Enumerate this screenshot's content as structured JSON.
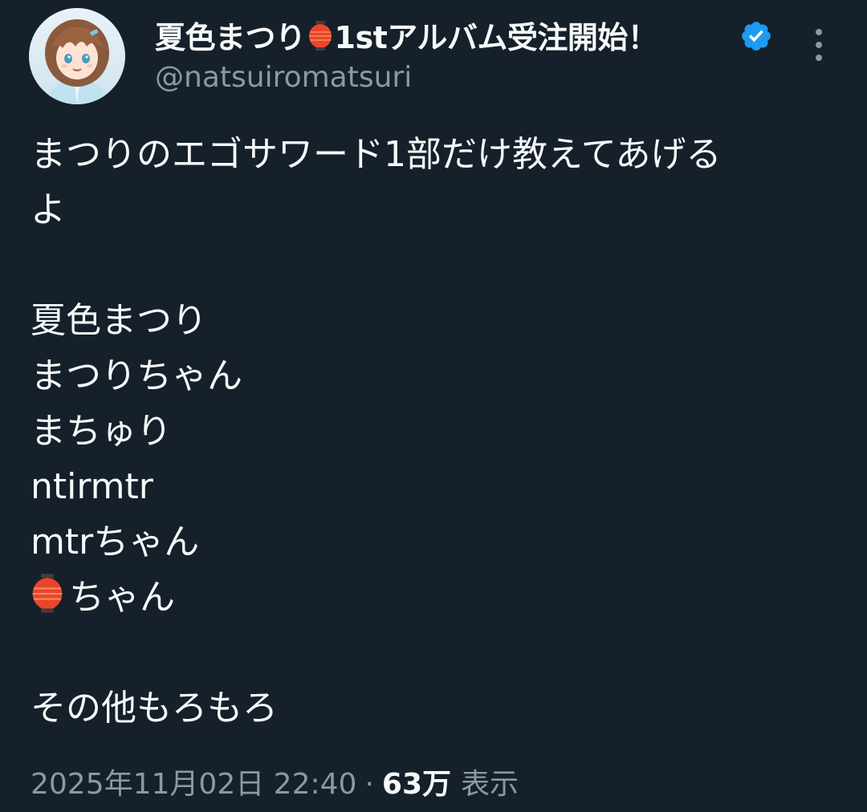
{
  "author": {
    "display_name": "夏色まつり",
    "display_name_suffix": "1stアルバム受注開始！",
    "handle": "@natsuiromatsuri"
  },
  "tweet": {
    "lines": [
      "まつりのエゴサワード1部だけ教えてあげる",
      "よ",
      "",
      "夏色まつり",
      "まつりちゃん",
      "まちゅり",
      "ntirmtr",
      "mtrちゃん",
      "ちゃん",
      "",
      "その他もろもろ"
    ]
  },
  "meta": {
    "timestamp": "2025年11月02日 22:40",
    "separator": "·",
    "views_count": "63万",
    "views_label": "表示"
  },
  "colors": {
    "background": "#15202b",
    "text_primary": "#f7f9f9",
    "text_secondary": "#8b98a5",
    "verified_blue": "#1d9bf0"
  },
  "icons": {
    "lantern": "lantern-icon",
    "verified": "verified-badge-icon",
    "more": "more-options-icon"
  }
}
